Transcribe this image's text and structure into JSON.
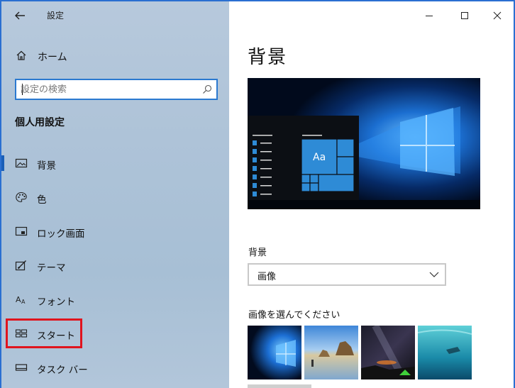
{
  "app": {
    "title": "設定"
  },
  "sidebar": {
    "home_label": "ホーム",
    "search_placeholder": "設定の検索",
    "section_title": "個人用設定",
    "items": [
      {
        "label": "背景",
        "icon": "picture-icon",
        "active": true
      },
      {
        "label": "色",
        "icon": "palette-icon",
        "active": false
      },
      {
        "label": "ロック画面",
        "icon": "lock-screen-icon",
        "active": false
      },
      {
        "label": "テーマ",
        "icon": "theme-brush-icon",
        "active": false
      },
      {
        "label": "フォント",
        "icon": "font-icon",
        "active": false
      },
      {
        "label": "スタート",
        "icon": "start-tiles-icon",
        "active": false
      },
      {
        "label": "タスク バー",
        "icon": "taskbar-icon",
        "active": false
      }
    ]
  },
  "main": {
    "page_title": "背景",
    "preview_tile_text": "Aa",
    "background_label": "背景",
    "background_value": "画像",
    "choose_label": "画像を選んでください"
  },
  "colors": {
    "accent": "#2b79d0",
    "highlight_box": "#e0141e",
    "tile_blue": "#2e8bd6"
  }
}
